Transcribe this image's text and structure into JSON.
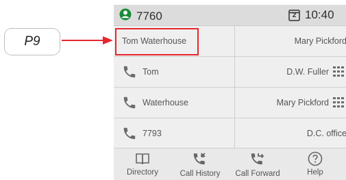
{
  "callout": {
    "label": "P9"
  },
  "status_bar": {
    "extension": "7760",
    "time": "10:40",
    "calendar_day": "2"
  },
  "line_keys": {
    "left": [
      {
        "label": "Tom Waterhouse",
        "icon": "none"
      },
      {
        "label": "Tom",
        "icon": "phone-icon"
      },
      {
        "label": "Waterhouse",
        "icon": "phone-icon"
      },
      {
        "label": "7793",
        "icon": "phone-icon"
      }
    ],
    "right": [
      {
        "label": "Mary Pickford",
        "icon": "none"
      },
      {
        "label": "D.W. Fuller",
        "icon": "blf-grid-icon"
      },
      {
        "label": "Mary Pickford",
        "icon": "blf-grid-icon"
      },
      {
        "label": "D.C. office",
        "icon": "none"
      }
    ]
  },
  "soft_keys": [
    {
      "label": "Directory",
      "icon": "book-icon"
    },
    {
      "label": "Call History",
      "icon": "call-history-icon"
    },
    {
      "label": "Call Forward",
      "icon": "call-forward-icon"
    },
    {
      "label": "Help",
      "icon": "help-icon"
    }
  ],
  "colors": {
    "highlight": "#e8262c",
    "accent_green": "#1b8c3a",
    "phone_icon": "#6b6b6b"
  }
}
